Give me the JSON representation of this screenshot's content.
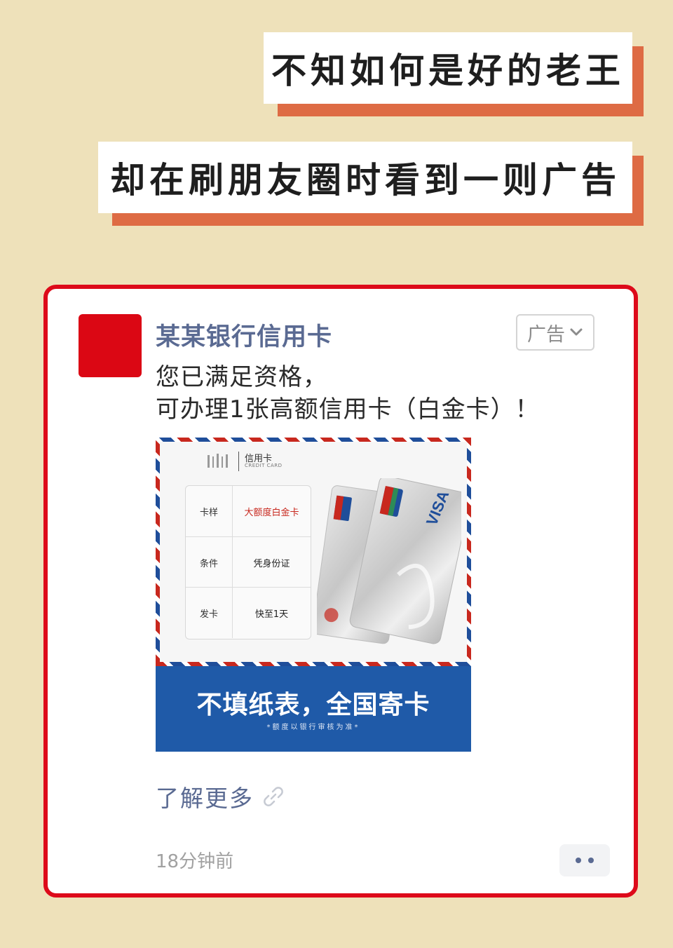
{
  "captions": {
    "line1": "不知如何是好的老王",
    "line2": "却在刷朋友圈时看到一则广告"
  },
  "ad": {
    "sender": "某某银行信用卡",
    "tag_label": "广告",
    "tag_icon": "chevron-down-icon",
    "body_line1": "您已满足资格，",
    "body_line2": "可办理1张高额信用卡（白金卡）！",
    "image": {
      "logo_cn": "信用卡",
      "logo_en": "CREDIT CARD",
      "rows": [
        {
          "key": "卡样",
          "value": "大额度白金卡"
        },
        {
          "key": "条件",
          "value": "凭身份证"
        },
        {
          "key": "发卡",
          "value": "快至1天"
        }
      ],
      "card_brands": [
        "UnionPay 银联",
        "VISA"
      ],
      "banner_main": "不填纸表，全国寄卡",
      "banner_sub": "*额度以银行审核为准*"
    },
    "learn_more": "了解更多",
    "link_icon": "link-icon",
    "timestamp": "18分钟前",
    "more_icon": "more-dots-icon"
  },
  "colors": {
    "background": "#EEE1BA",
    "caption_accent": "#DE6B44",
    "card_border": "#DD0A1A",
    "sender_color": "#5A6A92",
    "banner_blue": "#1F5AA8",
    "highlight_red": "#C8281E"
  }
}
